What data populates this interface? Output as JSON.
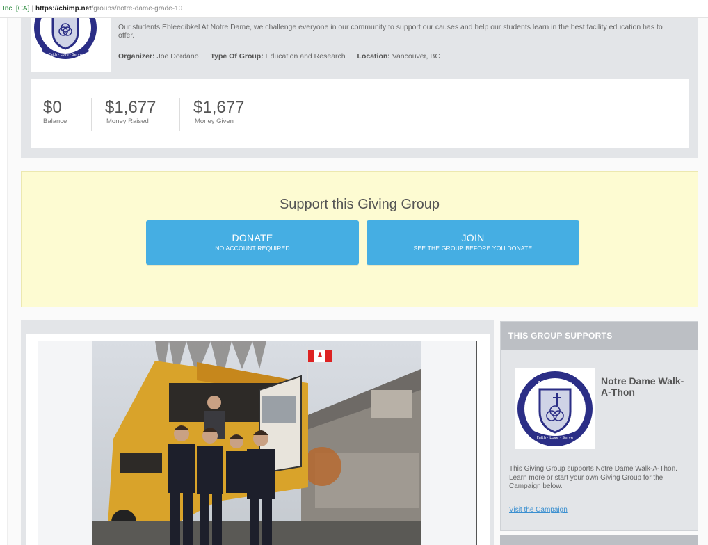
{
  "browser": {
    "security": "Inc. [CA]",
    "url_host": "https://chimp.net",
    "url_path": "/groups/notre-dame-grade-10"
  },
  "group": {
    "description": "Our students Ebleedibkel At Notre Dame, we challenge everyone in our community to support our causes and help our students learn in the best facility education has to offer.",
    "organizer_label": "Organizer:",
    "organizer": "Joe Dordano",
    "type_label": "Type Of Group:",
    "type": "Education and Research",
    "location_label": "Location:",
    "location": "Vancouver, BC",
    "stats": [
      {
        "value": "$0",
        "label": "Balance"
      },
      {
        "value": "$1,677",
        "label": "Money Raised"
      },
      {
        "value": "$1,677",
        "label": "Money Given"
      }
    ]
  },
  "support": {
    "title": "Support this Giving Group",
    "donate_label": "DONATE",
    "donate_sub": "NO ACCOUNT REQUIRED",
    "join_label": "JOIN",
    "join_sub": "SEE THE GROUP BEFORE YOU DONATE"
  },
  "sidebar": {
    "header": "THIS GROUP SUPPORTS",
    "campaign_name": "Notre Dame Walk-A-Thon",
    "description": "This Giving Group supports Notre Dame Walk-A-Thon. Learn more or start your own Giving Group for the Campaign below.",
    "link": "Visit the Campaign"
  },
  "logo": {
    "crest_text": "Notre Dame",
    "motto": "Faith · Love · Serve"
  },
  "colors": {
    "donate_blue": "#45aee3",
    "support_bg": "#fdfbd2",
    "panel_gray": "#e3e5e8",
    "crest_navy": "#2b2e86"
  }
}
